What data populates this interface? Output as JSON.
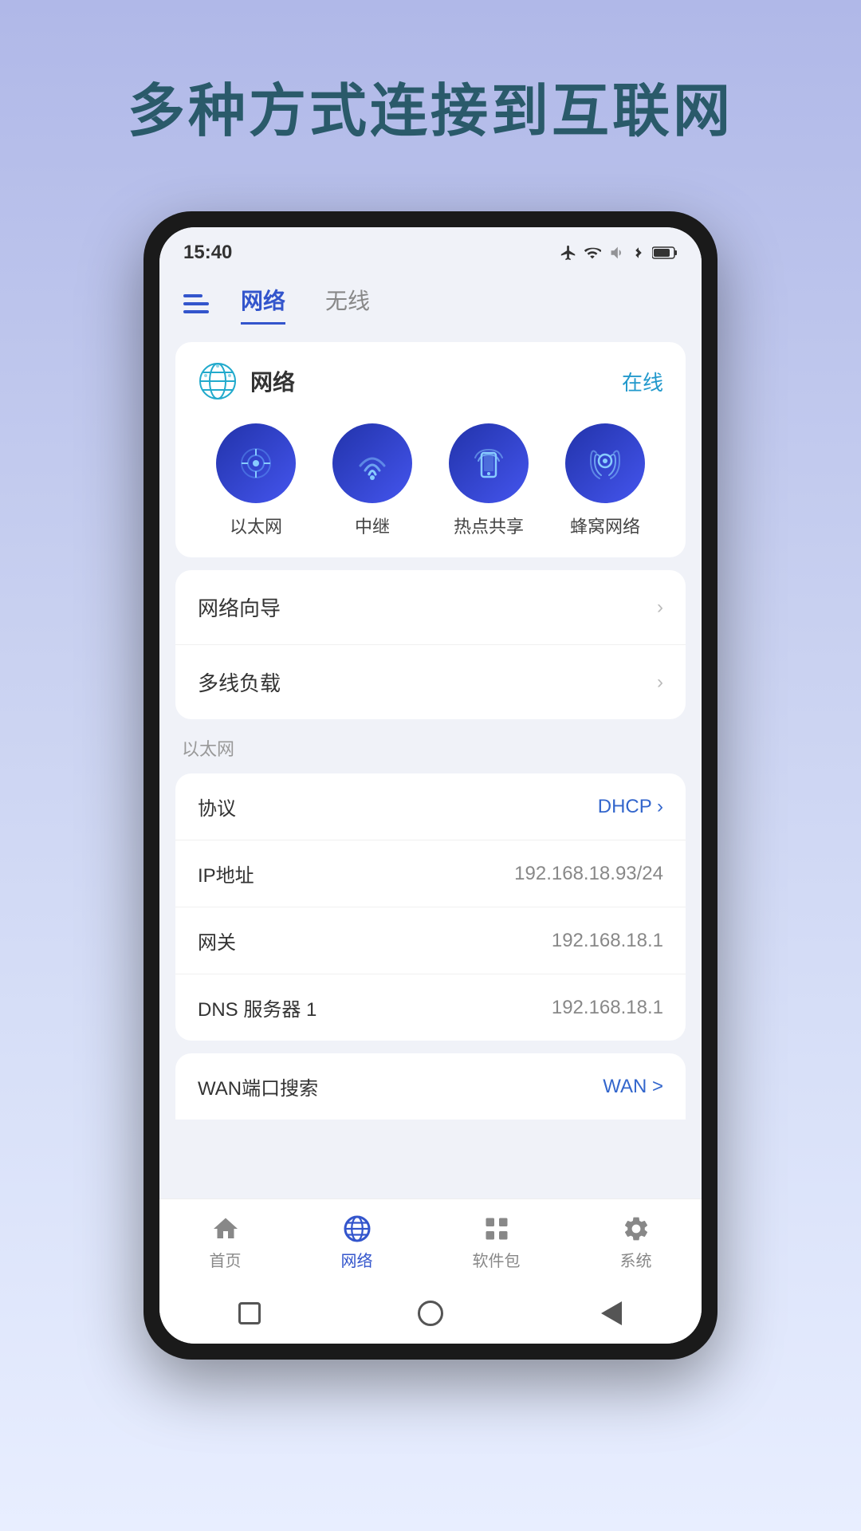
{
  "page": {
    "headline": "多种方式连接到互联网",
    "background_color_top": "#b0b8e8",
    "background_color_bottom": "#e8eeff"
  },
  "status_bar": {
    "time": "15:40",
    "icons": [
      "airplane",
      "wifi",
      "volume",
      "bluetooth",
      "battery"
    ]
  },
  "top_nav": {
    "tab_network": "网络",
    "tab_wireless": "无线",
    "active_tab": "network"
  },
  "network_section": {
    "title": "网络",
    "status": "在线",
    "icons": [
      {
        "label": "以太网",
        "icon": "ethernet"
      },
      {
        "label": "中继",
        "icon": "relay"
      },
      {
        "label": "热点共享",
        "icon": "hotspot"
      },
      {
        "label": "蜂窝网络",
        "icon": "cellular"
      }
    ]
  },
  "menu_rows": [
    {
      "label": "网络向导",
      "value": ""
    },
    {
      "label": "多线负载",
      "value": ""
    }
  ],
  "section_label": "以太网",
  "info_rows": [
    {
      "label": "协议",
      "value": "DHCP",
      "has_chevron": true,
      "value_color": "blue"
    },
    {
      "label": "IP地址",
      "value": "192.168.18.93/24",
      "value_color": "gray"
    },
    {
      "label": "网关",
      "value": "192.168.18.1",
      "value_color": "gray"
    },
    {
      "label": "DNS 服务器 1",
      "value": "192.168.18.1",
      "value_color": "gray"
    }
  ],
  "partial_row": {
    "label": "WAN端口搜索",
    "value": "WAN >"
  },
  "bottom_nav": [
    {
      "label": "首页",
      "icon": "home",
      "active": false
    },
    {
      "label": "网络",
      "icon": "network",
      "active": true
    },
    {
      "label": "软件包",
      "icon": "apps",
      "active": false
    },
    {
      "label": "系统",
      "icon": "settings",
      "active": false
    }
  ],
  "sys_nav": {
    "square_btn": "recent-apps",
    "circle_btn": "home",
    "back_btn": "back"
  }
}
